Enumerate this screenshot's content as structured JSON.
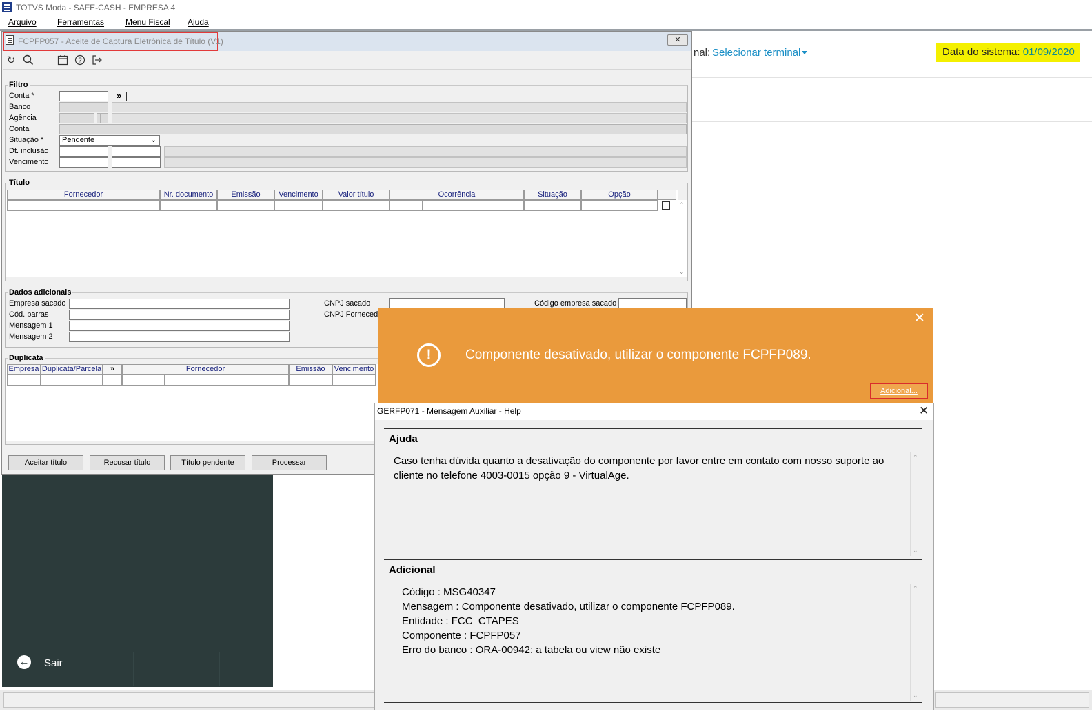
{
  "app": {
    "title": "TOTVS Moda - SAFE-CASH - EMPRESA 4"
  },
  "menubar": {
    "items": [
      "Arquivo",
      "Ferramentas",
      "Menu Fiscal",
      "Ajuda"
    ]
  },
  "web_header": {
    "terminal_label": "nal:",
    "terminal_link": "Selecionar terminal",
    "date_label": "Data do sistema:",
    "date_value": "01/09/2020"
  },
  "side_panel": {
    "exit_label": "Sair"
  },
  "form": {
    "title": "FCPFP057 - Aceite de Captura Eletrônica de Título (V1)",
    "close_glyph": "✕",
    "toolbar": {
      "refresh_icon": "↻",
      "search_icon": "🔍",
      "calendar_icon": "▦",
      "help_icon": "?",
      "exit_icon": "⇥"
    },
    "filtro": {
      "title": "Filtro",
      "conta_label": "Conta *",
      "banco_label": "Banco",
      "agencia_label": "Agência",
      "conta2_label": "Conta",
      "situacao_label": "Situação *",
      "situacao_value": "Pendente",
      "dt_inclusao_label": "Dt. inclusão",
      "vencimento_label": "Vencimento",
      "expand_glyph": "»"
    },
    "titulo": {
      "title": "Título",
      "columns": [
        "Fornecedor",
        "Nr. documento",
        "Emissão",
        "Vencimento",
        "Valor título",
        "Ocorrência",
        "Situação",
        "Opção"
      ]
    },
    "dados": {
      "title": "Dados adicionais",
      "empresa_sacado_label": "Empresa sacado",
      "cod_barras_label": "Cód. barras",
      "mensagem1_label": "Mensagem 1",
      "mensagem2_label": "Mensagem 2",
      "cnpj_sacado_label": "CNPJ sacado",
      "cnpj_fornecedor_label": "CNPJ Fornecedo",
      "codigo_empresa_label": "Código empresa sacado"
    },
    "duplicata": {
      "title": "Duplicata",
      "columns": [
        "Empresa",
        "Duplicata/Parcela",
        "»",
        "Fornecedor",
        "Emissão",
        "Vencimento"
      ]
    },
    "buttons": {
      "aceitar": "Aceitar título",
      "recusar": "Recusar título",
      "pendente": "Título pendente",
      "processar": "Processar"
    }
  },
  "orange_dialog": {
    "icon": "!",
    "message": "Componente desativado, utilizar o componente FCPFP089.",
    "additional_button": "Adicional...",
    "close_glyph": "✕"
  },
  "help_dialog": {
    "title": "GERFP071 - Mensagem Auxiliar - Help",
    "close_glyph": "✕",
    "ajuda_head": "Ajuda",
    "ajuda_text": "Caso tenha dúvida quanto a desativação do componente por favor entre em contato com nosso suporte ao cliente no telefone 4003-0015 opção 9 - VirtualAge.",
    "adicional_head": "Adicional",
    "adicional_lines": [
      "Código : MSG40347",
      "Mensagem : Componente desativado, utilizar o componente FCPFP089.",
      "Entidade : FCC_CTAPES",
      "Componente : FCPFP057",
      "Erro do banco : ORA-00942: a tabela ou view não existe"
    ]
  },
  "colors": {
    "accent_link": "#1a8fc6",
    "date_highlight": "#f4f000",
    "orange_dialog": "#ea9a3c",
    "dark_panel": "#2c3b3b",
    "highlight_border": "#e23a3a"
  }
}
